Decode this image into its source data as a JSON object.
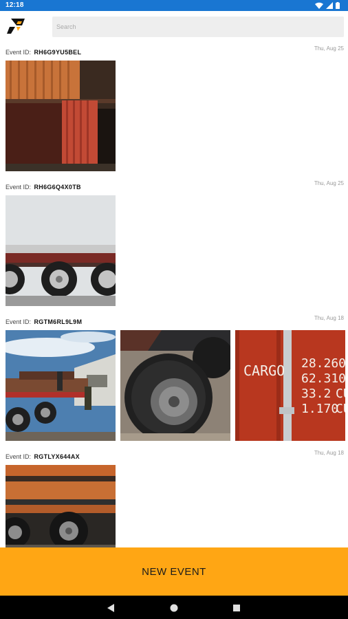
{
  "status_bar": {
    "time": "12:18",
    "bg_color": "#1976d2",
    "icons": [
      "wifi-icon",
      "signal-icon",
      "battery-icon"
    ]
  },
  "header": {
    "logo": "app-logo",
    "search_placeholder": "Search"
  },
  "events": [
    {
      "id_label": "Event ID:",
      "id": "RH6G9YU5BEL",
      "date": "Thu, Aug 25",
      "photos": [
        "shipping-container-photo"
      ]
    },
    {
      "id_label": "Event ID:",
      "id": "RH6G6Q4X0TB",
      "date": "Thu, Aug 25",
      "photos": [
        "trailer-wheels-photo"
      ]
    },
    {
      "id_label": "Event ID:",
      "id": "RGTM6RL9L9M",
      "date": "Thu, Aug 18",
      "photos": [
        "flatbed-truck-photo",
        "tire-closeup-photo",
        "cargo-container-photo"
      ]
    },
    {
      "id_label": "Event ID:",
      "id": "RGTLYX644AX",
      "date": "Thu, Aug 18",
      "photos": [
        "orange-trailer-photo"
      ]
    }
  ],
  "cargo_text": {
    "label": "CARGO",
    "numbers": [
      "28.260",
      "62.310",
      "33.2",
      "1.170"
    ],
    "units": [
      "CU",
      "CU"
    ]
  },
  "footer": {
    "new_event_label": "NEW EVENT",
    "accent_color": "#ffa614"
  },
  "nav_bar": {
    "icons": [
      "back-icon",
      "home-icon",
      "recents-icon"
    ]
  }
}
